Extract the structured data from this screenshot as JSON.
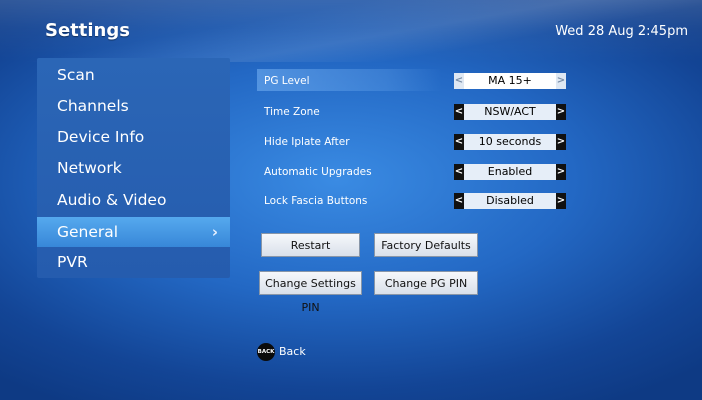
{
  "header": {
    "title": "Settings",
    "datetime": "Wed 28 Aug 2:45pm"
  },
  "sidebar": {
    "items": [
      {
        "label": "Scan"
      },
      {
        "label": "Channels"
      },
      {
        "label": "Device Info"
      },
      {
        "label": "Network"
      },
      {
        "label": "Audio & Video"
      },
      {
        "label": "General",
        "selected": true,
        "chevron": "chevron-right-icon"
      },
      {
        "label": "PVR"
      }
    ]
  },
  "settings": {
    "rows": [
      {
        "label": "PG Level",
        "value": "MA 15+",
        "highlighted": true
      },
      {
        "label": "Time Zone",
        "value": "NSW/ACT"
      },
      {
        "label": "Hide Iplate After",
        "value": "10 seconds"
      },
      {
        "label": "Automatic Upgrades",
        "value": "Enabled"
      },
      {
        "label": "Lock Fascia Buttons",
        "value": "Disabled"
      }
    ]
  },
  "buttons": {
    "restart": "Restart",
    "factory_defaults": "Factory Defaults",
    "change_settings_pin": "Change Settings PIN",
    "change_pg_pin": "Change PG PIN"
  },
  "back": {
    "icon_text": "BACK",
    "label": "Back"
  },
  "colors": {
    "background": "#2368c4",
    "sidebar": "#2b66b6",
    "sidebar_selected": "#3f8fe0",
    "text": "#ffffff"
  }
}
